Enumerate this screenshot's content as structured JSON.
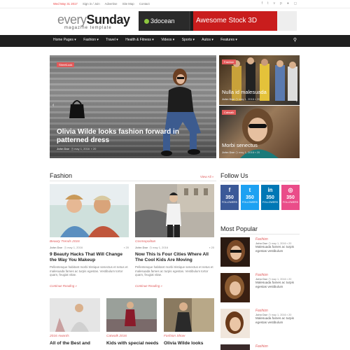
{
  "topbar": {
    "date": "Wed May 31 2017",
    "links": [
      "Sign in / Join",
      "Advertise",
      "Site Map",
      "Contact"
    ],
    "social_icons": [
      "facebook-icon",
      "twitter-icon",
      "vimeo-icon",
      "pinterest-icon",
      "flickr-icon",
      "instagram-icon"
    ]
  },
  "logo": {
    "part1": "every",
    "part2": "Sunday",
    "tagline": "magazine template"
  },
  "banner": {
    "brand": "3docean",
    "text": "Awesome Stock 3D"
  },
  "nav": {
    "items": [
      "Home Pages ▾",
      "Fashion ▾",
      "Travel ▾",
      "Health & Fitness ▾",
      "Videos ▾",
      "Sports ▾",
      "Autos ▾",
      "Features ▾"
    ]
  },
  "hero": {
    "tag": "StreetLook",
    "title": "Olivia Wilde looks fashion forward in patterned dress",
    "author": "John Doe",
    "date": "may 1, 2016",
    "comments": "20"
  },
  "featured": [
    {
      "tag": "Fashion",
      "title": "Nulla id malesuada",
      "author": "John Doe",
      "date": "may 1, 2016",
      "comments": "20"
    },
    {
      "tag": "Catwalk",
      "title": "Morbi senectus",
      "author": "John Doe",
      "date": "may 1, 2016",
      "comments": "20"
    }
  ],
  "fashion": {
    "heading": "Fashion",
    "view_all": "View All »",
    "articles": [
      {
        "category": "Beauty Trends 2016",
        "author": "John Doe",
        "date": "may 1, 2016",
        "comments": "20",
        "title": "9 Beauty Hacks That Will Change the Way You Makeup",
        "excerpt": "Pellentesque habitant morbi tristique senectus et netus et malesuada fames ac turpis egestas. Vestibulum tortor quam, feugiat vitae.",
        "more": "Continue Reading »"
      },
      {
        "category": "Cosmopolitan",
        "author": "John Doe",
        "date": "may 1, 2016",
        "comments": "20",
        "title": "Now This Is Four Cities Where All The Cool Kids Are Moving",
        "excerpt": "Pellentesque habitant morbi tristique senectus et netus et malesuada fames ac turpis egestas. Vestibulum tortor quam, feugiat vitae.",
        "more": "Continue Reading »"
      }
    ],
    "small": [
      {
        "category": "2016 Awards",
        "title": "All of the Best and"
      },
      {
        "category": "Catwalk 2016",
        "title": "Kids with special needs"
      },
      {
        "category": "Fashion Show",
        "title": "Olivia Wilde looks"
      }
    ]
  },
  "follow": {
    "heading": "Follow Us",
    "items": [
      {
        "icon": "f",
        "count": "350",
        "label": "FOLLOWERS",
        "color": "#3b5998"
      },
      {
        "icon": "t",
        "count": "350",
        "label": "FOLLOWERS",
        "color": "#1da1f2"
      },
      {
        "icon": "in",
        "count": "350",
        "label": "FOLLOWERS",
        "color": "#0077b5"
      },
      {
        "icon": "◎",
        "count": "350",
        "label": "FOLLOWERS",
        "color": "#ea4c89"
      }
    ]
  },
  "popular": {
    "heading": "Most Popular",
    "items": [
      {
        "category": "Fashion",
        "author": "John Doe",
        "date": "may 1, 2016",
        "comments": "20",
        "title": "Malesuada fames ac turpis egestas vestibulum"
      },
      {
        "category": "Fashion",
        "author": "John Doe",
        "date": "may 1, 2016",
        "comments": "20",
        "title": "Malesuada fames ac turpis egestas vestibulum"
      },
      {
        "category": "Fashion",
        "author": "John Doe",
        "date": "may 1, 2016",
        "comments": "20",
        "title": "Malesuada fames ac turpis egestas vestibulum"
      },
      {
        "category": "Fashion",
        "author": "",
        "date": "",
        "comments": "",
        "title": ""
      }
    ]
  },
  "colors": {
    "accent": "#e05a5a",
    "nav_bg": "#1f1f1f"
  }
}
